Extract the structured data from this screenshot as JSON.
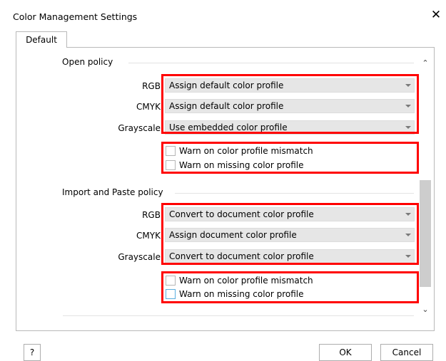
{
  "window": {
    "title": "Color Management Settings",
    "close_glyph": "✕"
  },
  "tabs": [
    {
      "label": "Default"
    }
  ],
  "open_policy": {
    "heading": "Open policy",
    "rows": [
      {
        "label": "RGB:",
        "value": "Assign default color profile"
      },
      {
        "label": "CMYK:",
        "value": "Assign default color profile"
      },
      {
        "label": "Grayscale:",
        "value": "Use embedded color profile"
      }
    ],
    "checks": [
      {
        "label": "Warn on color profile mismatch",
        "checked": false
      },
      {
        "label": "Warn on missing color profile",
        "checked": false
      }
    ]
  },
  "import_policy": {
    "heading": "Import and Paste policy",
    "rows": [
      {
        "label": "RGB:",
        "value": "Convert to document color profile"
      },
      {
        "label": "CMYK:",
        "value": "Assign document color profile"
      },
      {
        "label": "Grayscale:",
        "value": "Convert to document color profile"
      }
    ],
    "checks": [
      {
        "label": "Warn on color profile mismatch",
        "checked": false
      },
      {
        "label": "Warn on missing color profile",
        "checked": false
      }
    ]
  },
  "scroll": {
    "up_glyph": "⌃",
    "down_glyph": "⌄"
  },
  "buttons": {
    "help": "?",
    "ok": "OK",
    "cancel": "Cancel"
  },
  "colors": {
    "highlight": "#ff0000",
    "focus": "#5aaedf"
  }
}
